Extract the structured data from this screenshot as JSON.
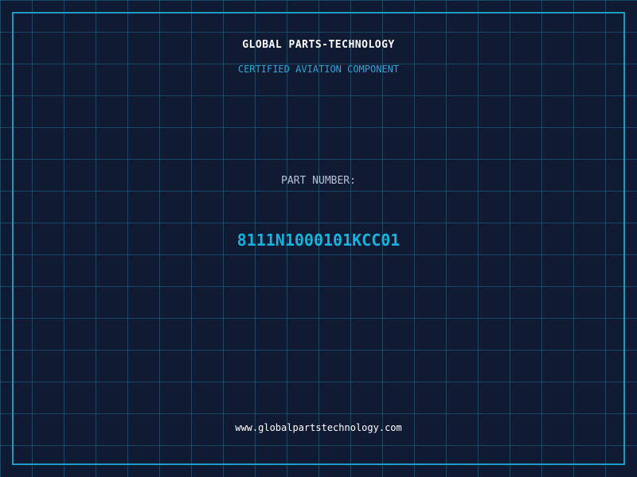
{
  "header": {
    "company": "GLOBAL PARTS-TECHNOLOGY",
    "tagline": "CERTIFIED AVIATION COMPONENT"
  },
  "part": {
    "label": "PART NUMBER:",
    "number": "8111N1000101KCC01"
  },
  "footer": {
    "url": "www.globalpartstechnology.com"
  },
  "colors": {
    "background": "#111a33",
    "grid": "#1e6e8c",
    "accent": "#14b4dc",
    "frame": "#1a9dc4"
  }
}
